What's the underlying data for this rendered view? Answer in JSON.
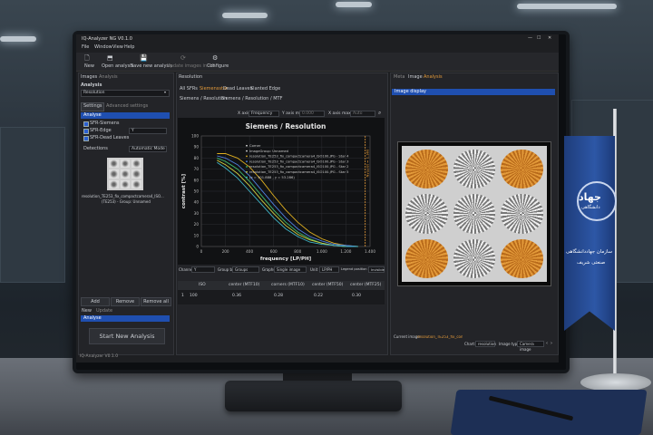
{
  "window": {
    "title": "IQ-Analyzer NG V0.1.0",
    "menu": [
      "File",
      "Window",
      "View",
      "Help"
    ],
    "footer": "IQ-Analyzer V0.1.0"
  },
  "toolbar": [
    "New",
    "Open analysis",
    "Save new analysis",
    "Update images in DB",
    "Configure"
  ],
  "left": {
    "tabs": [
      "Images",
      "Analysis"
    ],
    "analysis_label": "Analysis",
    "analysis_select": "Resolution",
    "settings_tabs": [
      "Settings",
      "Advanced settings"
    ],
    "analyse_label": "Analyse",
    "checks": [
      "SFR-Siemens",
      "SFR-Edge",
      "SFR-Dead Leaves"
    ],
    "edge_select": "Y",
    "detections_label": "Detections",
    "detections_select": "Automatic Mode",
    "image_caption_1": "resolution_TE253_fix_compactcamera4_ISO...",
    "image_caption_2": "(TE253) - Group: Unnamed",
    "buttons": [
      "Add",
      "Remove",
      "Remove all"
    ],
    "lower_tabs": [
      "New",
      "Update"
    ],
    "lower_item": "Analyse",
    "start_button": "Start New Analysis"
  },
  "center": {
    "title": "Resolution",
    "tabs": [
      "All SFRs",
      "Siemensstar",
      "Dead Leaves",
      "Slanted Edge"
    ],
    "breadcrumb_1": "Siemens / Resolution",
    "breadcrumb_2": "Siemens / Resolution / MTF",
    "x_axis_label": "X axis",
    "x_axis_value": "Frequency",
    "y_axis_min_label": "Y axis min",
    "y_axis_min_value": "0.000",
    "x_axis_max_label": "X axis max",
    "x_axis_max_value": "Auto",
    "bottom_controls": [
      "Channel",
      "Y",
      "Group by",
      "Groups",
      "Graphs",
      "Single image",
      "Unit",
      "LP/PH",
      "Legend position",
      "Invisible"
    ],
    "table": {
      "headers": [
        "",
        "ISO",
        "center (MTF10)",
        "corners (MTF10)",
        "center (MTF50)",
        "center (MTF25)"
      ],
      "rows": [
        [
          "1",
          "100",
          "0.36",
          "0.28",
          "0.22",
          "0.30"
        ]
      ]
    }
  },
  "chart_data": {
    "type": "line",
    "title": "Siemens / Resolution",
    "xlabel": "frequency [LP/PH]",
    "ylabel": "contrast [%]",
    "xlim": [
      0,
      1400
    ],
    "ylim": [
      0,
      100
    ],
    "xticks": [
      "0",
      "200",
      "400",
      "600",
      "800",
      "1.000",
      "1.200",
      "1.400"
    ],
    "yticks": [
      "0",
      "10",
      "20",
      "30",
      "40",
      "50",
      "60",
      "70",
      "80",
      "90",
      "100"
    ],
    "nyquist_label": "Nyquist = 1.360",
    "legend_items": [
      "Corner",
      "ImageGroup: Unnamed",
      "resolution_TE253_fix_compactcamera4_ISO100.JPG - Star 4",
      "resolution_TE253_fix_compactcamera4_ISO100.JPG - Star 3",
      "resolution_TE253_fix_compactcamera4_ISO100.JPG - Star 2",
      "resolution_TE253_fix_compactcamera4_ISO100.JPG - Star 5",
      "(x = 301.888 , y = 53.286)"
    ],
    "series": [
      {
        "color": "#e0b020",
        "x": [
          130,
          200,
          300,
          400,
          500,
          600,
          700,
          800,
          900,
          1000,
          1100,
          1200,
          1300
        ],
        "y": [
          84,
          84,
          80,
          72,
          60,
          46,
          33,
          22,
          13,
          7,
          3,
          1,
          0
        ]
      },
      {
        "color": "#4f7fe0",
        "x": [
          130,
          200,
          300,
          400,
          500,
          600,
          700,
          800,
          900,
          1000,
          1100,
          1200,
          1300
        ],
        "y": [
          82,
          80,
          74,
          64,
          51,
          38,
          26,
          16,
          9,
          5,
          2,
          1,
          0
        ]
      },
      {
        "color": "#3fbf6f",
        "x": [
          130,
          200,
          300,
          400,
          500,
          600,
          700,
          800,
          900,
          1000,
          1100,
          1200,
          1300
        ],
        "y": [
          80,
          77,
          70,
          59,
          46,
          33,
          22,
          13,
          7,
          3,
          1,
          0,
          0
        ]
      },
      {
        "color": "#d0d040",
        "x": [
          130,
          200,
          300,
          400,
          500,
          600,
          700,
          800,
          900,
          1000,
          1100,
          1200,
          1300
        ],
        "y": [
          78,
          74,
          66,
          55,
          42,
          30,
          19,
          11,
          6,
          3,
          1,
          0,
          0
        ]
      },
      {
        "color": "#3fb6c8",
        "x": [
          130,
          200,
          300,
          400,
          500,
          600,
          700,
          800,
          900,
          1000,
          1100,
          1200,
          1300
        ],
        "y": [
          76,
          71,
          62,
          50,
          38,
          26,
          16,
          9,
          4,
          2,
          1,
          0,
          0
        ]
      }
    ]
  },
  "right": {
    "tabs": [
      "Meta",
      "Image",
      "Analysis"
    ],
    "panel_title": "Image display",
    "current_image_label": "Current image:",
    "current_image_value": "resolution_TE253_fix_compactcamera4_ISO100.JPG",
    "chart_label": "Chart:",
    "chart_value": "resolution",
    "image_type_label": "Image type:",
    "image_type_value": "Camera image"
  },
  "flag": {
    "title": "جهاد",
    "subtitle": "دانشگاهی",
    "line1": "سازمان جهاددانشگاهی",
    "line2": "صنعتی شریف"
  },
  "colors": {
    "accent": "#1f4fb0",
    "orange": "#e39a3a",
    "chart_bg": "#111214"
  }
}
